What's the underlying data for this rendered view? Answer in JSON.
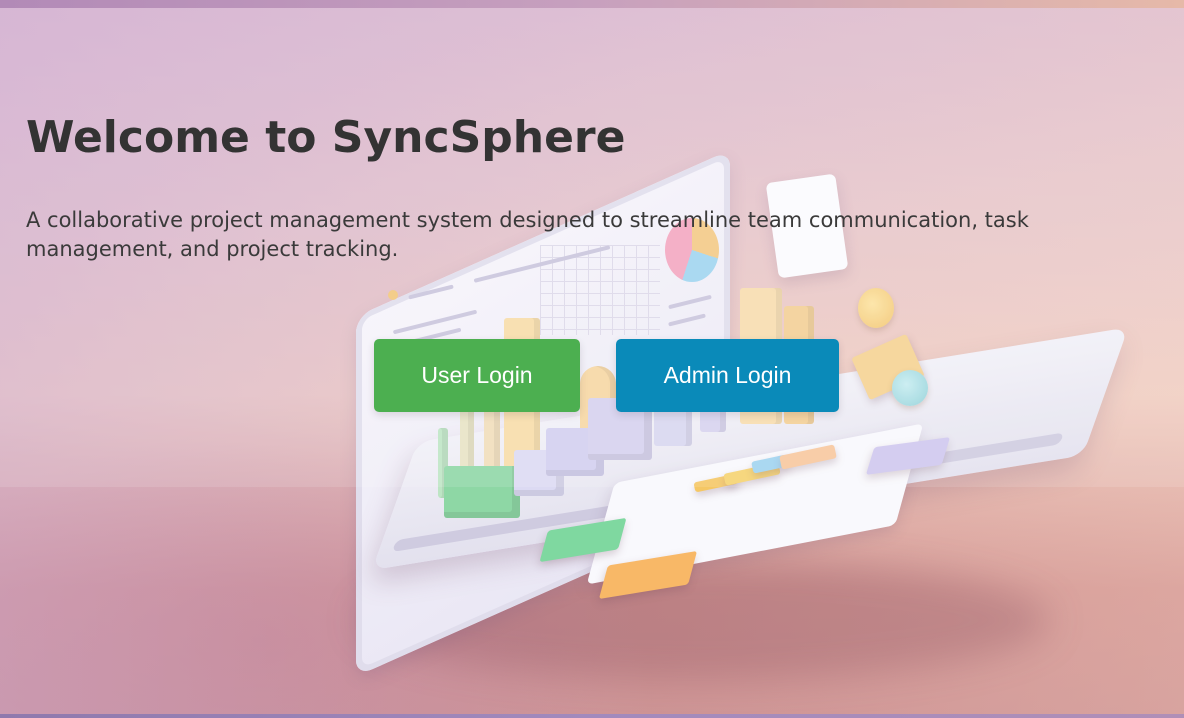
{
  "hero": {
    "title": "Welcome to SyncSphere",
    "subtitle": "A collaborative project management system designed to streamline team communication, task management, and project tracking."
  },
  "actions": {
    "user_login_label": "User Login",
    "admin_login_label": "Admin Login"
  },
  "colors": {
    "user_login_button": "#4caf50",
    "admin_login_button": "#0a8ab9",
    "heading_text": "#333333"
  }
}
